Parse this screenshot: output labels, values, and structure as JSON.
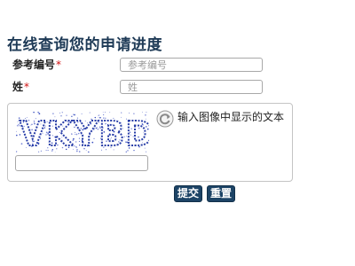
{
  "form": {
    "title": "在线查询您的申请进度",
    "reference": {
      "label": "参考编号",
      "required_mark": "*",
      "placeholder": "参考编号",
      "value": ""
    },
    "surname": {
      "label": "姓",
      "required_mark": "*",
      "placeholder": "姓",
      "value": ""
    },
    "captcha": {
      "image_text": "VKYBD",
      "refresh_icon": "refresh-icon",
      "hint": "输入图像中显示的文本",
      "value": ""
    },
    "buttons": {
      "submit_label": "提交",
      "reset_label": "重置"
    }
  },
  "colors": {
    "title": "#1e3a56",
    "required": "#d01010",
    "button_bg": "#1d4466",
    "captcha_text": "#2a3fa8"
  }
}
